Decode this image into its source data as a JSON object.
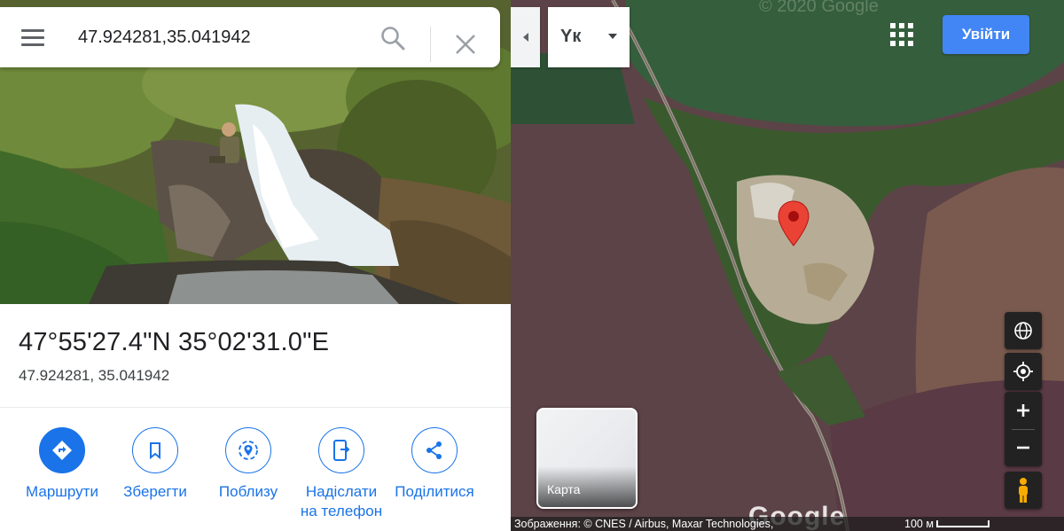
{
  "search": {
    "value": "47.924281,35.041942"
  },
  "place": {
    "title": "47°55'27.4\"N 35°02'31.0\"E",
    "decimal": "47.924281, 35.041942"
  },
  "actions": [
    {
      "label": "Маршрути",
      "icon": "directions-icon"
    },
    {
      "label": "Зберегти",
      "icon": "bookmark-icon"
    },
    {
      "label": "Поблизу",
      "icon": "nearby-icon"
    },
    {
      "label_line1": "Надіслати",
      "label_line2": "на телефон",
      "icon": "send-to-phone-icon"
    },
    {
      "label": "Поділитися",
      "icon": "share-icon"
    }
  ],
  "map": {
    "layer_mode_label": "Yк",
    "signin_label": "Увійти",
    "layer_thumb_label": "Карта",
    "attribution": "Зображення: © CNES / Airbus, Maxar Technologies,",
    "scale_label": "100 м",
    "copyright_watermark": "© 2020 Google",
    "logo_text": "Google"
  },
  "colors": {
    "accent": "#1a73e8",
    "signin": "#4285f4",
    "pin": "#ea4335"
  }
}
